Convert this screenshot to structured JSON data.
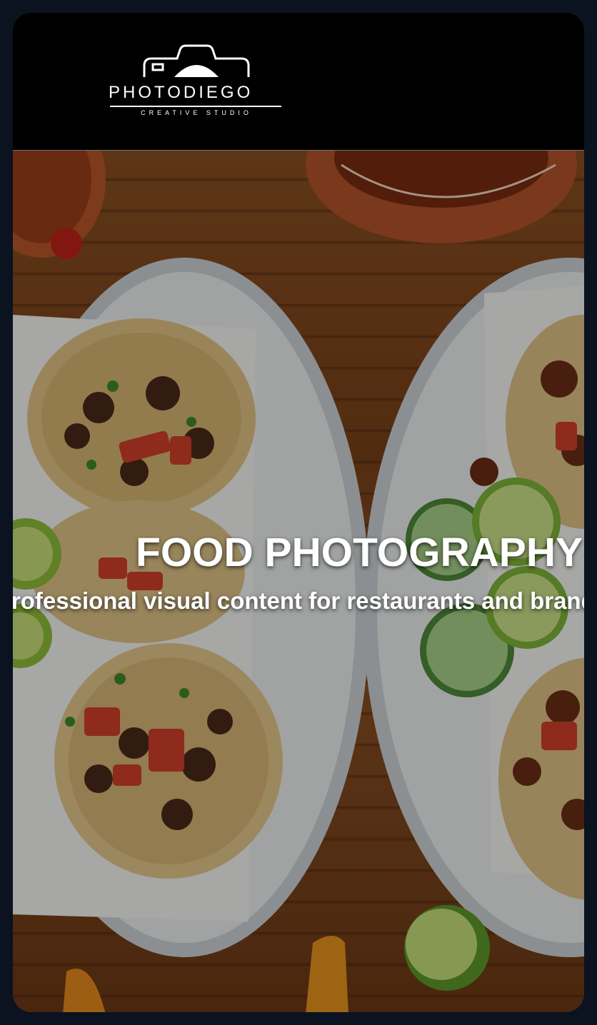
{
  "brand": {
    "name": "PHOTODIEGO",
    "tagline": "CREATIVE STUDIO"
  },
  "hero": {
    "title": "FOOD PHOTOGRAPHY",
    "subtitle": "Professional visual content for restaurants and brands"
  },
  "colors": {
    "page_background": "#0b1220",
    "header_background": "#000000",
    "text": "#ffffff"
  },
  "icons": {
    "logo": "camera-logo-icon"
  }
}
